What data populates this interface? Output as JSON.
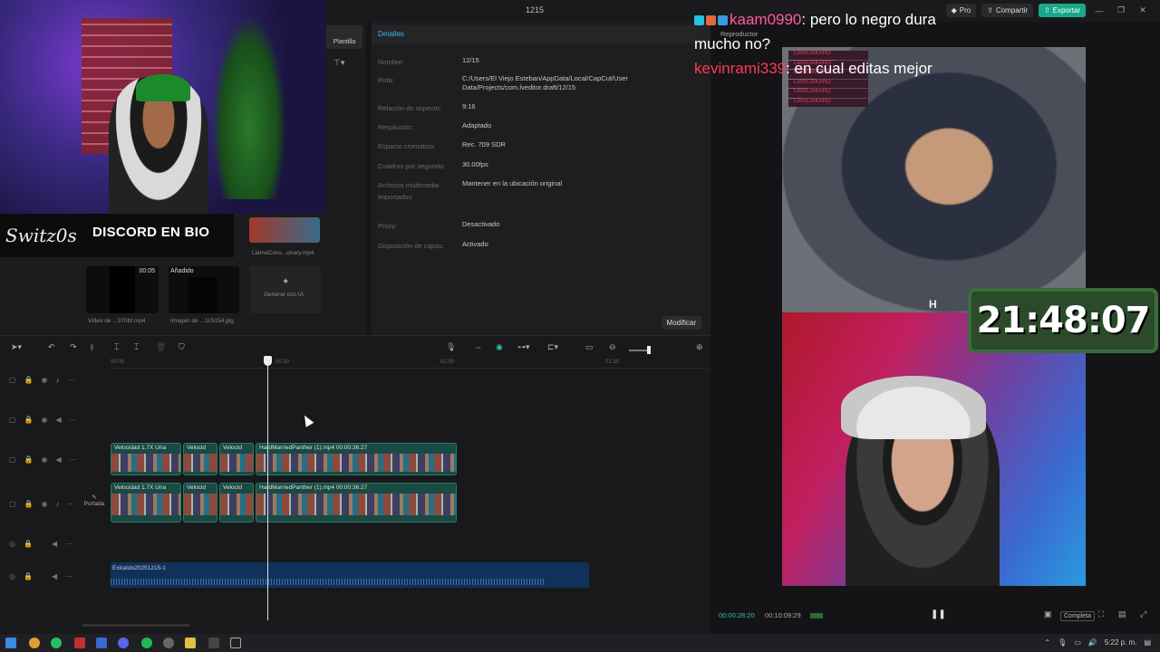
{
  "window": {
    "title": "1215"
  },
  "topbar": {
    "pro_label": "Pro",
    "share_label": "Compartir",
    "export_label": "Exportar"
  },
  "stream": {
    "banner_logo": "Switz0s",
    "banner_text": "DISCORD EN BIO",
    "timer": "21:48:07",
    "meme_letter": "H"
  },
  "chat": [
    {
      "user": "kaam0990",
      "message": ": pero lo negro dura mucho no?"
    },
    {
      "user": "kevinrami339",
      "message": ": en cual editas mejor"
    }
  ],
  "chat_stack": [
    "LAVIEJAKARO",
    "LAVIEJAKARO",
    "LAVIEJAKARO",
    "LAVIEJAKARO",
    "LAVIEJAKARO",
    "LAVIEJAKARO"
  ],
  "media": {
    "thumbs": [
      {
        "caption": "LlamaCons...onary.mp4"
      },
      {
        "duration": "00:05",
        "caption": "Video de ...370bf.mp4"
      },
      {
        "tag": "Añadido",
        "caption": "Imagen de ...1c5154.jpg"
      },
      {
        "caption": "Generar con IA"
      }
    ]
  },
  "side": {
    "tab_label": "Plantilla"
  },
  "details": {
    "title": "Detalles",
    "rows": [
      {
        "label": "Nombre:",
        "value": "12/15"
      },
      {
        "label": "Ruta:",
        "value": "C:/Users/El Viejo Esteban/AppData/Local/CapCut/User Data/Projects/com.lveditor.draft/12/15"
      },
      {
        "label": "Relación de aspecto:",
        "value": "9:16"
      },
      {
        "label": "Resolución:",
        "value": "Adaptado"
      },
      {
        "label": "Espacio cromático:",
        "value": "Rec. 709 SDR"
      },
      {
        "label": "Cuadros por segundo:",
        "value": "30.00fps"
      },
      {
        "label": "Archivos multimedia importados:",
        "value": "Mantener en la ubicación original"
      },
      {
        "label": "Proxy:",
        "value": "Desactivado"
      },
      {
        "label": "Disposición de capas:",
        "value": "Activado"
      }
    ],
    "modify_label": "Modificar"
  },
  "timeline": {
    "ruler": [
      "00:00",
      "00:30",
      "01:00",
      "01:30"
    ],
    "clips": [
      {
        "label": "Velocidad 1.7X   Una"
      },
      {
        "label": "Velocid"
      },
      {
        "label": "Velocid"
      },
      {
        "label": "HardMarriedPanther (1).mp4   00:00:36:27"
      }
    ],
    "cover_label": "Portada",
    "audio_label": "Extraído20251215-1"
  },
  "player": {
    "label": "Reproductor",
    "current_time": "00:00:28:20",
    "total_time": "00:10:09:29",
    "full_label": "Completa"
  },
  "taskbar": {
    "time": "5:22 p. m."
  },
  "colors": {
    "accent": "#27c4a4",
    "export": "#1aa88a",
    "detail_link": "#3ab6e8"
  }
}
